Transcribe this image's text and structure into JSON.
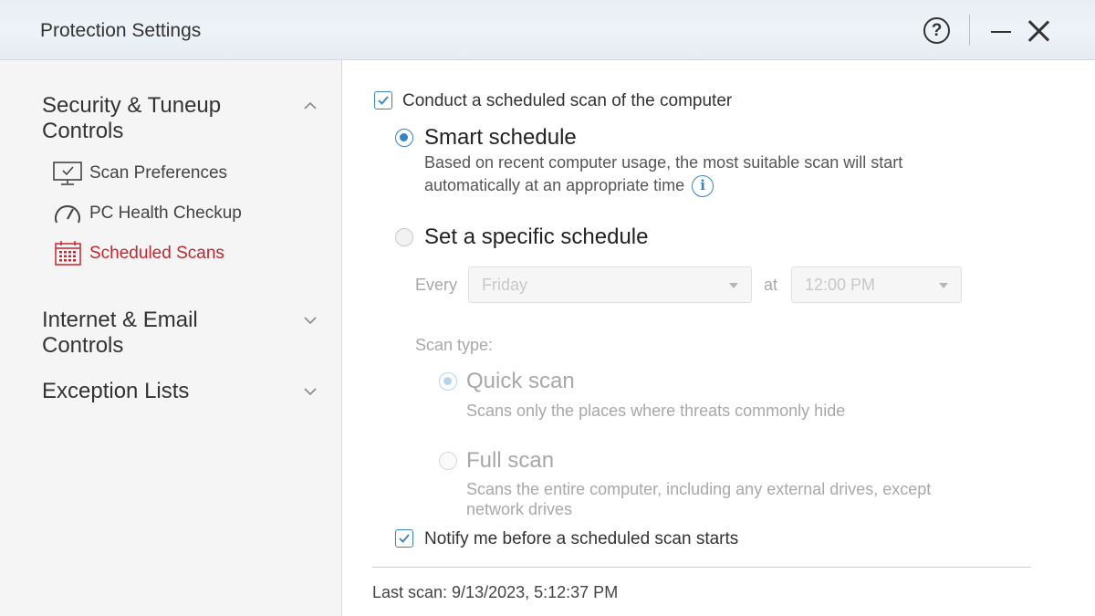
{
  "window": {
    "title": "Protection Settings",
    "help_label": "?",
    "icons": [
      "help-icon",
      "minimize-icon",
      "close-icon"
    ]
  },
  "sidebar": {
    "sections": [
      {
        "label_line1": "Security & Tuneup",
        "label_line2": "Controls",
        "expanded": true
      },
      {
        "label_line1": "Internet & Email",
        "label_line2": "Controls",
        "expanded": false
      },
      {
        "label_line1": "Exception Lists",
        "expanded": false
      }
    ],
    "items": [
      {
        "label": "Scan Preferences",
        "icon": "monitor-icon"
      },
      {
        "label": "PC Health Checkup",
        "icon": "gauge-icon"
      },
      {
        "label": "Scheduled Scans",
        "icon": "calendar-icon",
        "active": true
      }
    ]
  },
  "main": {
    "conduct_label": "Conduct a scheduled scan of the computer",
    "conduct_checked": true,
    "smart": {
      "label": "Smart schedule",
      "desc_line1": "Based on recent computer usage, the most suitable scan will start",
      "desc_line2": "automatically at an appropriate time",
      "info_glyph": "i",
      "selected": true
    },
    "specific": {
      "label": "Set a specific schedule",
      "selected": false,
      "every_label": "Every",
      "day_value": "Friday",
      "at_label": "at",
      "time_value": "12:00 PM"
    },
    "scan_type": {
      "label": "Scan type:",
      "quick": {
        "label": "Quick scan",
        "desc": "Scans only the places where threats commonly hide",
        "selected": true
      },
      "full": {
        "label": "Full scan",
        "desc_line1": "Scans the entire computer, including any external drives, except",
        "desc_line2": "network drives",
        "selected": false
      }
    },
    "notify_label": "Notify me before a scheduled scan starts",
    "notify_checked": true,
    "last_scan": "Last scan: 9/13/2023, 5:12:37 PM"
  },
  "colors": {
    "accent": "#3b82c4",
    "active": "#c3262e",
    "disabled": "#a8a8a8"
  }
}
